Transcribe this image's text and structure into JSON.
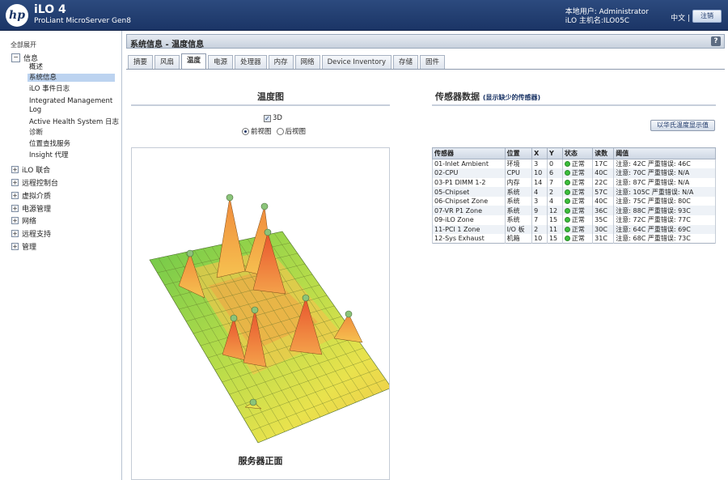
{
  "header": {
    "logo": "hp",
    "product": "iLO 4",
    "server": "ProLiant MicroServer Gen8",
    "user_line": "本地用户: Administrator",
    "host_line": "iLO 主机名:ILO05C",
    "lang": "中文 |",
    "logout": "注销"
  },
  "sidebar": {
    "expand_all": "全部展开",
    "info": {
      "label": "信息",
      "items": [
        "概述",
        "系统信息",
        "iLO 事件日志",
        "Integrated Management",
        "Log",
        "Active Health System 日志",
        "诊断",
        "位置查找服务",
        "Insight 代理"
      ],
      "selected_index": 1
    },
    "sections": [
      "iLO 联合",
      "远程控制台",
      "虚拟介质",
      "电源管理",
      "网络",
      "远程支持",
      "管理"
    ]
  },
  "main": {
    "title": "系统信息 - 温度信息",
    "help": "?",
    "tabs": [
      "摘要",
      "风扇",
      "温度",
      "电源",
      "处理器",
      "内存",
      "网络",
      "Device Inventory",
      "存储",
      "固件"
    ],
    "active_tab": 2
  },
  "temp_panel": {
    "title": "温度图",
    "checkbox_3d": "3D",
    "front_view": "前视图",
    "rear_view": "后视图",
    "caption": "服务器正面"
  },
  "sensor_panel": {
    "title": "传感器数据",
    "link": "(显示缺少的传感器)",
    "unit_button": "以华氏温度显示值",
    "columns": [
      "传感器",
      "位置",
      "X",
      "Y",
      "状态",
      "读数",
      "阈值"
    ],
    "rows": [
      [
        "01-Inlet Ambient",
        "环境",
        "3",
        "0",
        "正常",
        "17C",
        "注意: 42C 严重错误: 46C"
      ],
      [
        "02-CPU",
        "CPU",
        "10",
        "6",
        "正常",
        "40C",
        "注意: 70C 严重错误: N/A"
      ],
      [
        "03-P1 DIMM 1-2",
        "内存",
        "14",
        "7",
        "正常",
        "22C",
        "注意: 87C 严重错误: N/A"
      ],
      [
        "05-Chipset",
        "系统",
        "4",
        "2",
        "正常",
        "57C",
        "注意: 105C 严重错误: N/A"
      ],
      [
        "06-Chipset Zone",
        "系统",
        "3",
        "4",
        "正常",
        "40C",
        "注意: 75C 严重错误: 80C"
      ],
      [
        "07-VR P1 Zone",
        "系统",
        "9",
        "12",
        "正常",
        "36C",
        "注意: 88C 严重错误: 93C"
      ],
      [
        "09-iLO Zone",
        "系统",
        "7",
        "15",
        "正常",
        "35C",
        "注意: 72C 严重错误: 77C"
      ],
      [
        "11-PCI 1 Zone",
        "I/O 板",
        "2",
        "11",
        "正常",
        "30C",
        "注意: 64C 严重错误: 69C"
      ],
      [
        "12-Sys Exhaust",
        "机箱",
        "10",
        "15",
        "正常",
        "31C",
        "注意: 68C 严重错误: 73C"
      ]
    ]
  }
}
